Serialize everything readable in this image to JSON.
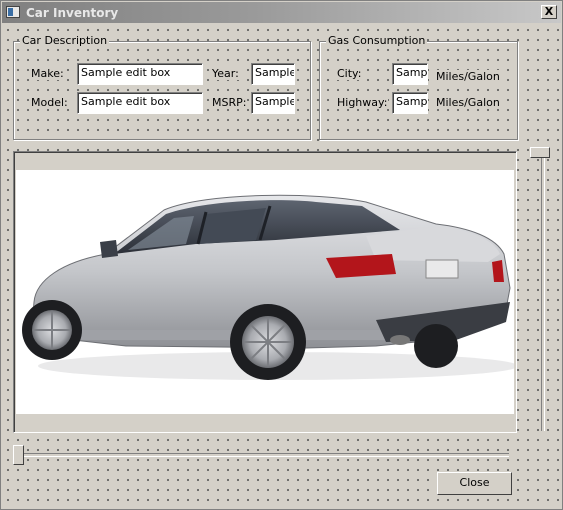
{
  "window": {
    "title": "Car Inventory",
    "close_glyph": "X"
  },
  "car_description": {
    "title": "Car Description",
    "make_label": "Make:",
    "make_value": "Sample edit box",
    "model_label": "Model:",
    "model_value": "Sample edit box",
    "year_label": "Year:",
    "year_value": "Sample",
    "msrp_label": "MSRP:",
    "msrp_value": "Sample"
  },
  "gas_consumption": {
    "title": "Gas Consumption",
    "city_label": "City:",
    "city_value": "Sample",
    "city_unit": "Miles/Galon",
    "highway_label": "Highway:",
    "highway_value": "Sample",
    "highway_unit": "Miles/Galon"
  },
  "buttons": {
    "close": "Close"
  },
  "icons": [
    "app-window-icon",
    "close-icon",
    "car-photo"
  ],
  "colors": {
    "dialog_face": "#d4d0c8",
    "car_body": "#c9cacd"
  }
}
